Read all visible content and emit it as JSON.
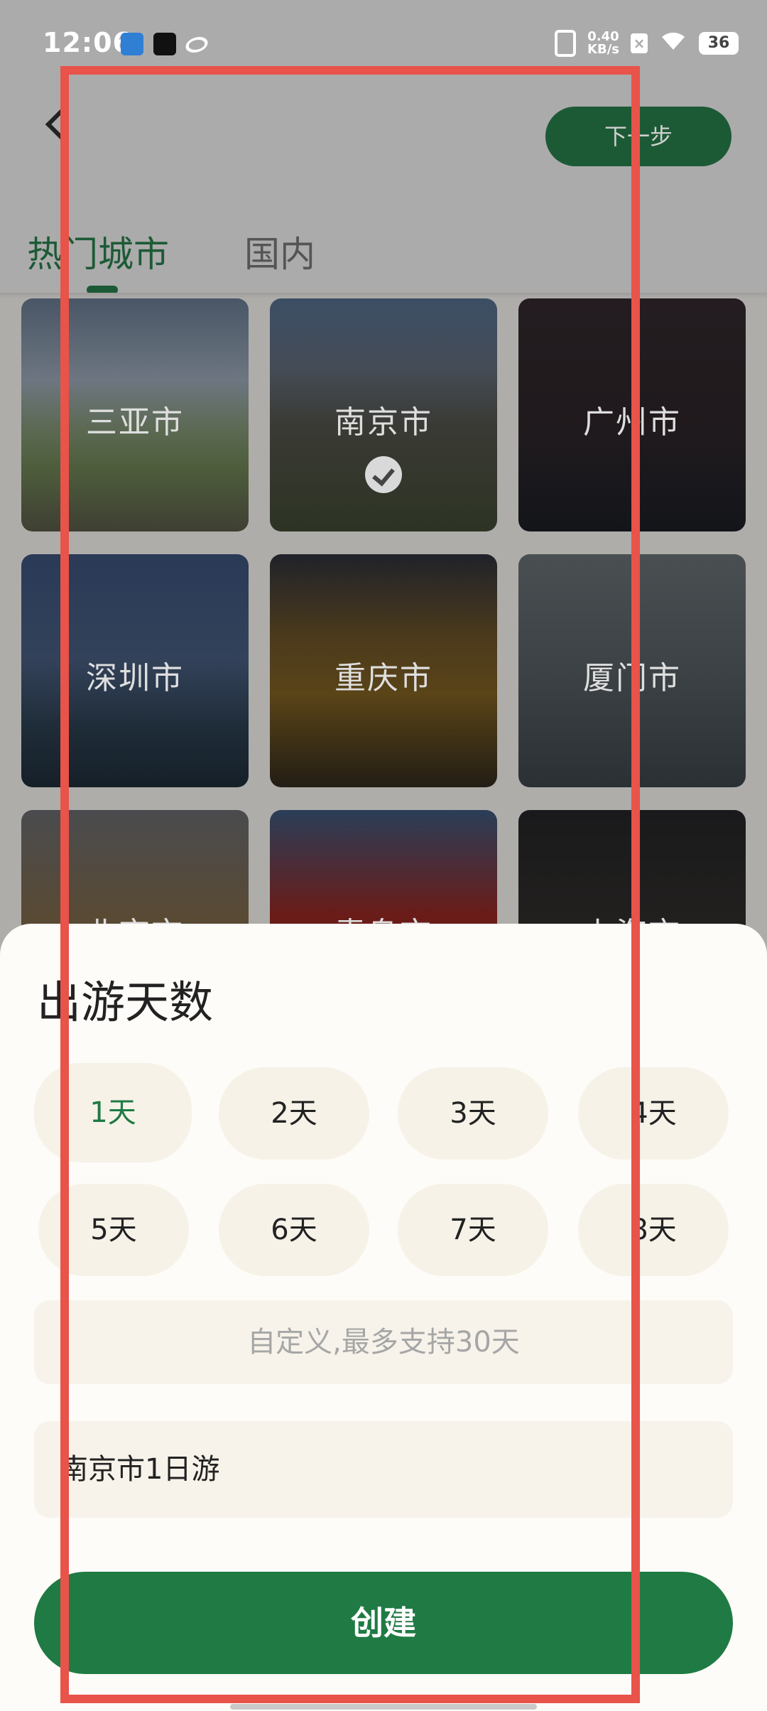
{
  "status_bar": {
    "time": "12:06",
    "net_speed_value": "0.40",
    "net_speed_unit": "KB/s",
    "battery": "36"
  },
  "header": {
    "next_label": "下一步",
    "tabs": [
      {
        "label": "热门城市",
        "active": true
      },
      {
        "label": "国内",
        "active": false
      }
    ]
  },
  "cities": [
    {
      "name": "三亚市",
      "selected": false
    },
    {
      "name": "南京市",
      "selected": true
    },
    {
      "name": "广州市",
      "selected": false
    },
    {
      "name": "深圳市",
      "selected": false
    },
    {
      "name": "重庆市",
      "selected": false
    },
    {
      "name": "厦门市",
      "selected": false
    },
    {
      "name": "北京市",
      "selected": false
    },
    {
      "name": "青岛市",
      "selected": false
    },
    {
      "name": "上海市",
      "selected": false
    }
  ],
  "sheet": {
    "title": "出游天数",
    "days": [
      "1天",
      "2天",
      "3天",
      "4天",
      "5天",
      "6天",
      "7天",
      "8天"
    ],
    "selected_day": "1天",
    "custom_placeholder": "自定义,最多支持30天",
    "trip_name": "南京市1日游",
    "create_label": "创建"
  },
  "colors": {
    "accent": "#1f7a44",
    "highlight": "#e8534a"
  }
}
